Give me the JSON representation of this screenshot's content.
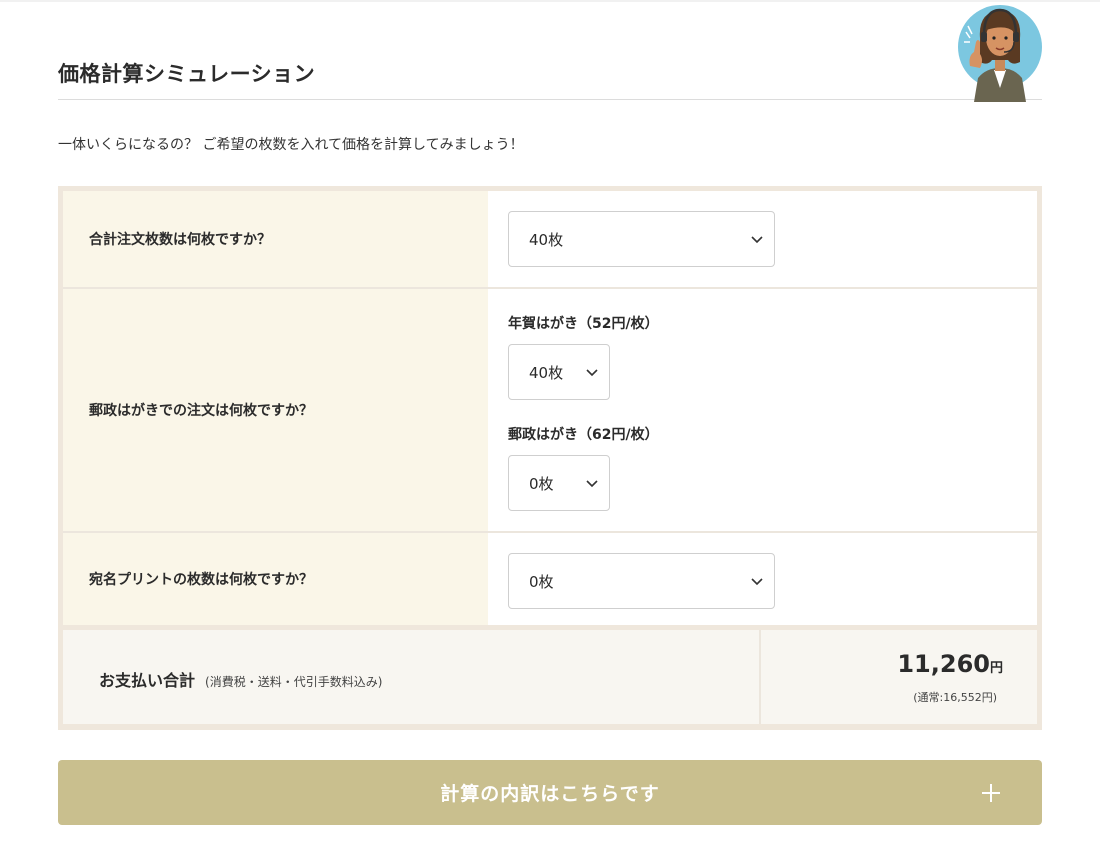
{
  "page": {
    "title": "価格計算シミュレーション",
    "lead": "一体いくらになるの？ ご希望の枚数を入れて価格を計算してみましょう！"
  },
  "rows": {
    "total_count": {
      "label": "合計注文枚数は何枚ですか？",
      "value": "40枚"
    },
    "postcard": {
      "label": "郵政はがきでの注文は何枚ですか？",
      "nenga_label": "年賀はがき（52円/枚）",
      "nenga_value": "40枚",
      "yusei_label": "郵政はがき（62円/枚）",
      "yusei_value": "0枚"
    },
    "address_print": {
      "label": "宛名プリントの枚数は何枚ですか？",
      "value": "0枚"
    }
  },
  "total": {
    "label": "お支払い合計",
    "note": "(消費税・送料・代引手数料込み)",
    "amount": "11,260",
    "unit": "円",
    "regular": "(通常:16,552円)"
  },
  "cta": {
    "label": "計算の内訳はこちらです",
    "icon": "plus-icon"
  },
  "colors": {
    "label_bg": "#faf6e8",
    "frame": "#efe7dc",
    "total_bg": "#f8f6f1",
    "cta_bg": "#c9bf8e",
    "avatar_circle": "#7cc7e0"
  }
}
